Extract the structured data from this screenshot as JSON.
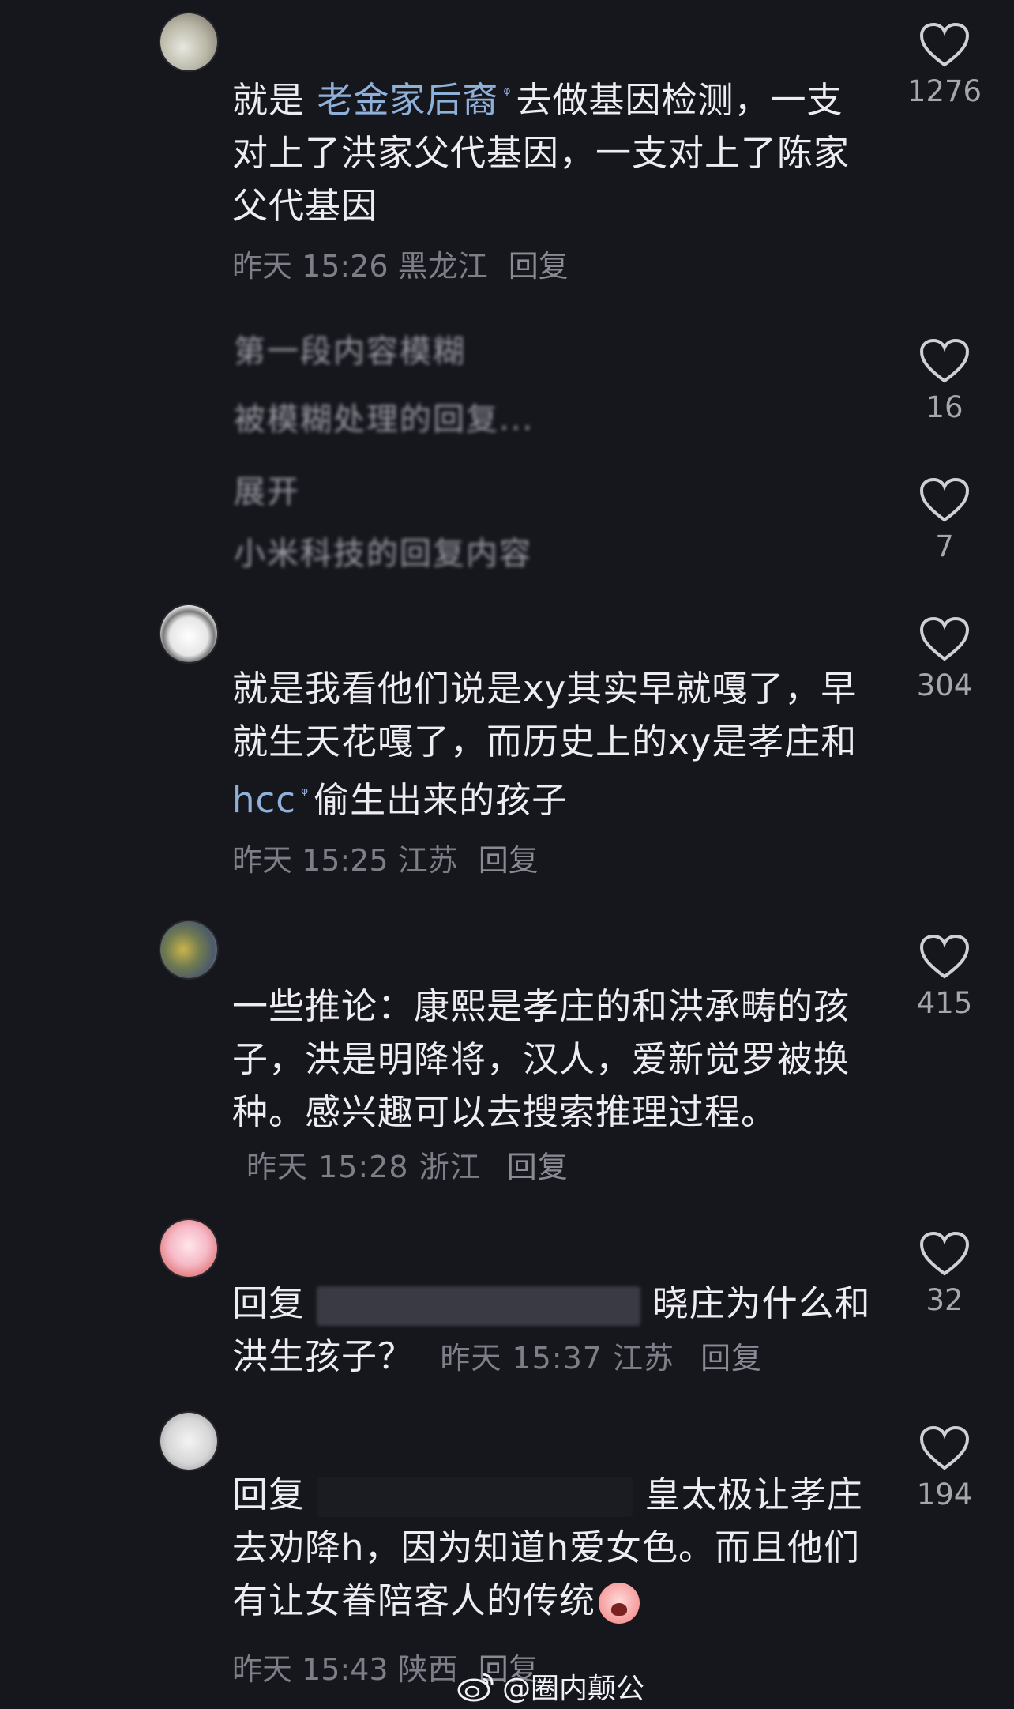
{
  "comments": [
    {
      "text_prefix": "就是 ",
      "link": "老金家后裔",
      "text_suffix": "去做基因检测，一支对上了洪家父代基因，一支对上了陈家父代基因",
      "time": "昨天 15:26",
      "location": "黑龙江",
      "reply": "回复",
      "likes": "1276"
    },
    {
      "blurred_lines": [
        "第一段内容模糊",
        "被模糊处理的回复...",
        "展开",
        "小米科技的回复内容"
      ],
      "likes_a": "16",
      "likes_b": "7"
    },
    {
      "text_prefix": "就是我看他们说是xy其实早就嘎了，早就生天花嘎了，而历史上的xy是孝庄和 ",
      "link": "hcc",
      "text_suffix": "偷生出来的孩子",
      "time": "昨天 15:25",
      "location": "江苏",
      "reply": "回复",
      "likes": "304"
    },
    {
      "text": "一些推论：康熙是孝庄的和洪承畴的孩子，洪是明降将，汉人，爱新觉罗被换种。感兴趣可以去搜索推理过程。",
      "time": "昨天 15:28",
      "location": "浙江",
      "reply": "回复",
      "likes": "415"
    },
    {
      "reply_prefix": "回复",
      "text": "晓庄为什么和洪生孩子？",
      "time": "昨天 15:37",
      "location": "江苏",
      "reply": "回复",
      "likes": "32"
    },
    {
      "reply_prefix": "回复",
      "text": "皇太极让孝庄去劝降h，因为知道h爱女色。而且他们有让女眷陪客人的传统",
      "time": "昨天 15:43",
      "location": "陕西",
      "reply": "回复",
      "likes": "194"
    }
  ],
  "watermark": "@圈内颠公",
  "colors": {
    "background": "#16161d",
    "text": "#ececf1",
    "meta": "#7e7e88",
    "link": "#8fb0d8"
  }
}
